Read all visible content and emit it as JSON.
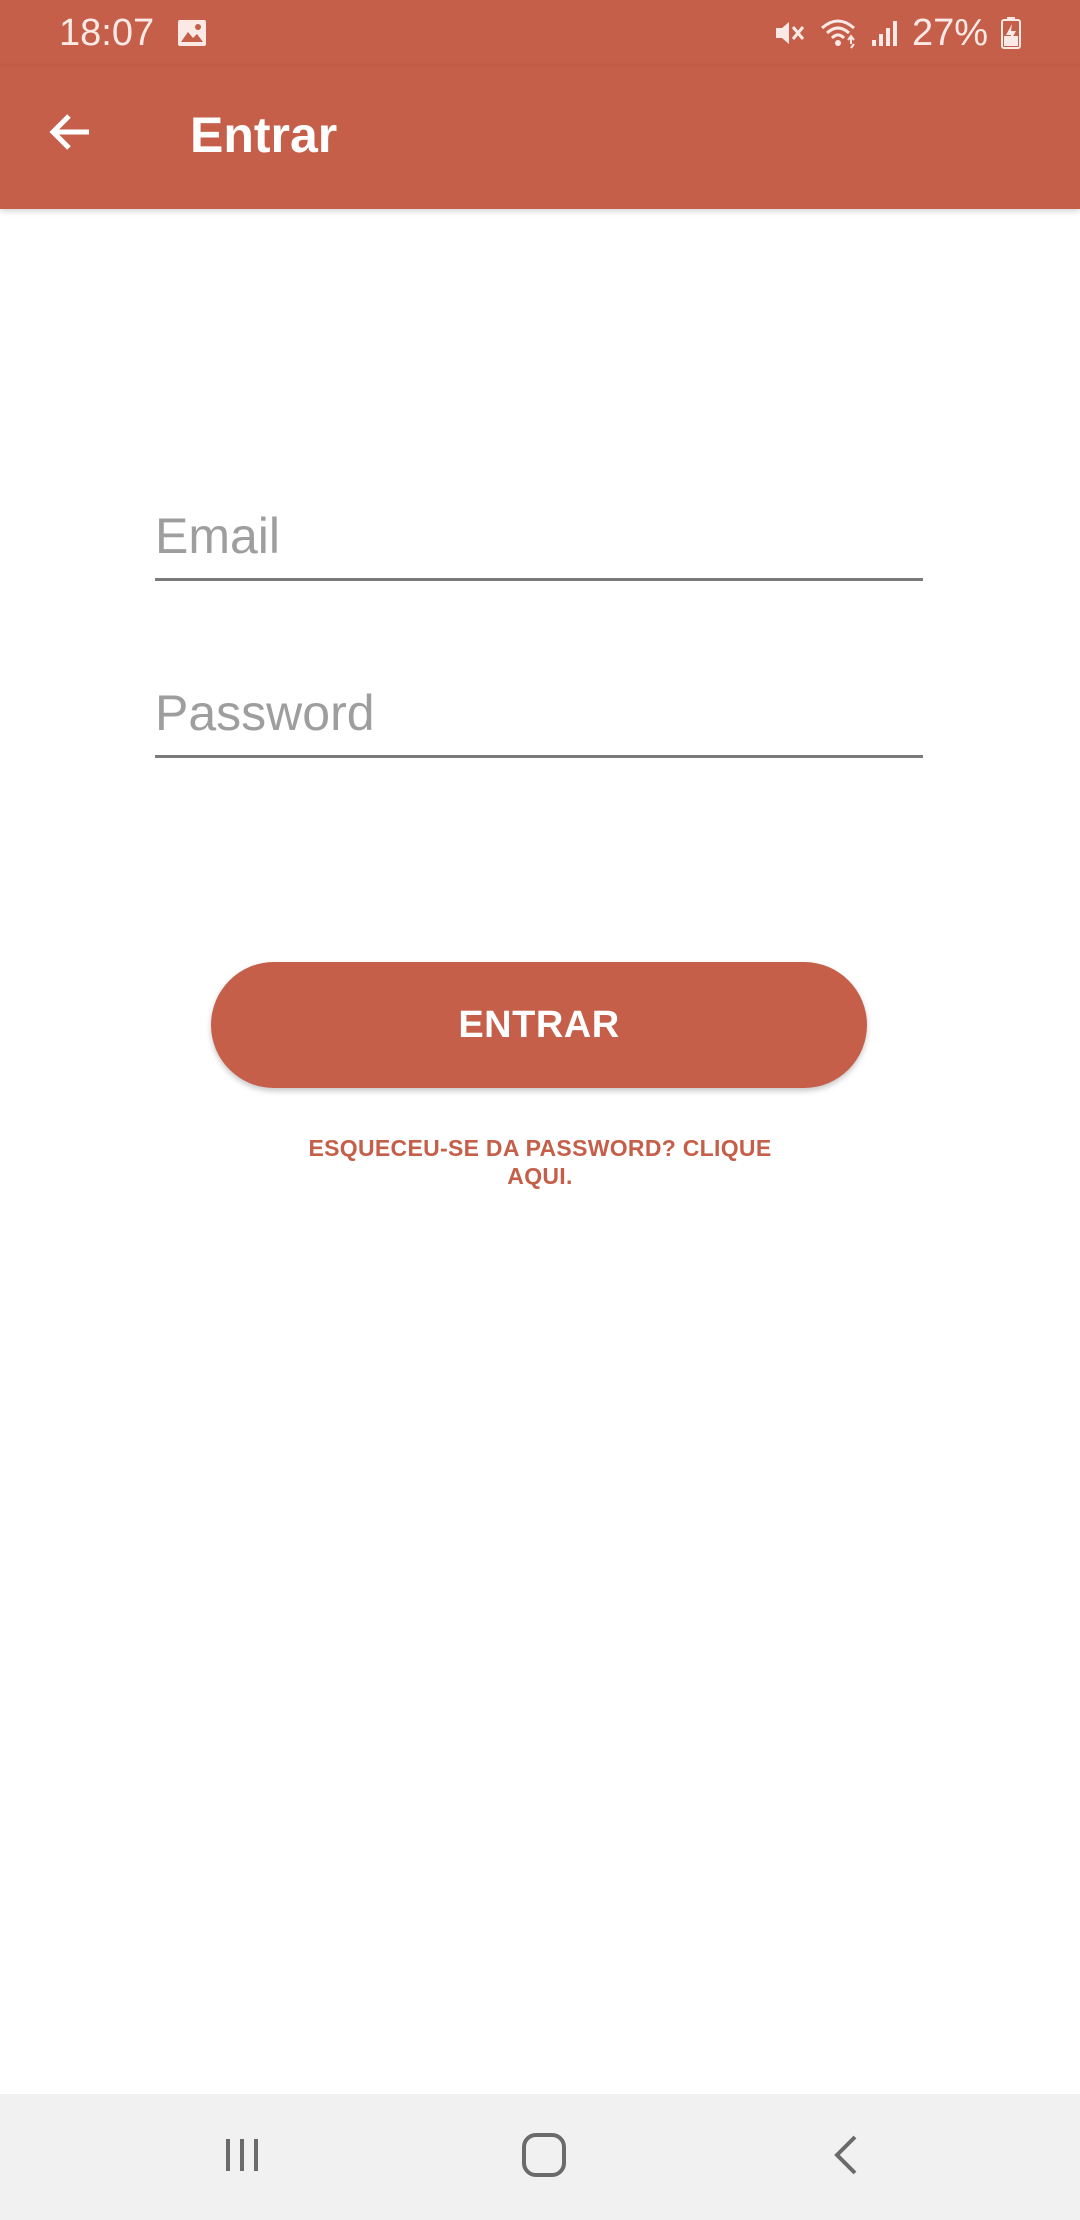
{
  "status_bar": {
    "time": "18:07",
    "battery_percent": "27%",
    "icons": [
      "image-icon",
      "mute-icon",
      "wifi-icon",
      "signal-icon",
      "battery-charging-icon"
    ]
  },
  "app_bar": {
    "title": "Entrar",
    "back_icon": "arrow-left-icon"
  },
  "form": {
    "email_placeholder": "Email",
    "email_value": "",
    "password_placeholder": "Password",
    "password_value": "",
    "submit_label": "ENTRAR",
    "forgot_link_line1": "ESQUECEU-SE DA PASSWORD? CLIQUE",
    "forgot_link_line2": "AQUI."
  },
  "nav_bar": {
    "icons": [
      "recents-icon",
      "home-icon",
      "back-icon"
    ]
  },
  "colors": {
    "accent": "#c55f4a",
    "nav_background": "#f1f1f1",
    "underline": "#7a7a7a",
    "placeholder": "#9e9e9e"
  }
}
